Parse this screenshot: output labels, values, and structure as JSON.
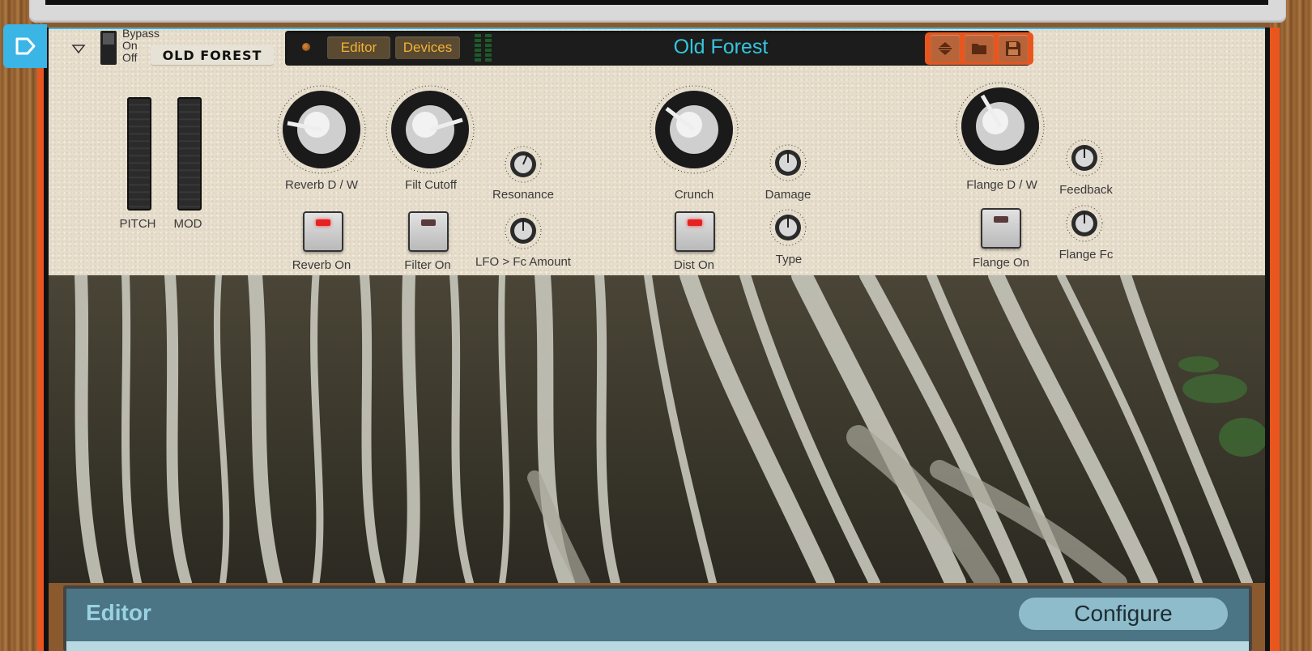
{
  "device": {
    "bypass_labels": [
      "Bypass",
      "On",
      "Off"
    ],
    "name_tape": "OLD FOREST",
    "editor_button": "Editor",
    "devices_button": "Devices",
    "patch_name": "Old Forest",
    "colors": {
      "accent_orange": "#e8561e",
      "display_cyan": "#35c6de",
      "header_button_text": "#f2b233",
      "panel_bg": "#e7ddcb"
    }
  },
  "controls": {
    "pitch_label": "PITCH",
    "mod_label": "MOD",
    "reverb_dw": "Reverb D / W",
    "filt_cutoff": "Filt Cutoff",
    "resonance": "Resonance",
    "lfo_fc_amount": "LFO > Fc Amount",
    "crunch": "Crunch",
    "damage": "Damage",
    "type": "Type",
    "flange_dw": "Flange D / W",
    "feedback": "Feedback",
    "flange_fc": "Flange Fc",
    "reverb_on": "Reverb On",
    "filter_on": "Filter On",
    "dist_on": "Dist On",
    "flange_on": "Flange On"
  },
  "button_states": {
    "reverb_on": true,
    "filter_on": false,
    "dist_on": true,
    "flange_on": false
  },
  "icons": [
    "fold-tab-icon",
    "collapse-arrow-icon",
    "patch-up-down-icon",
    "folder-icon",
    "save-icon"
  ],
  "editor": {
    "title": "Editor",
    "configure": "Configure"
  }
}
